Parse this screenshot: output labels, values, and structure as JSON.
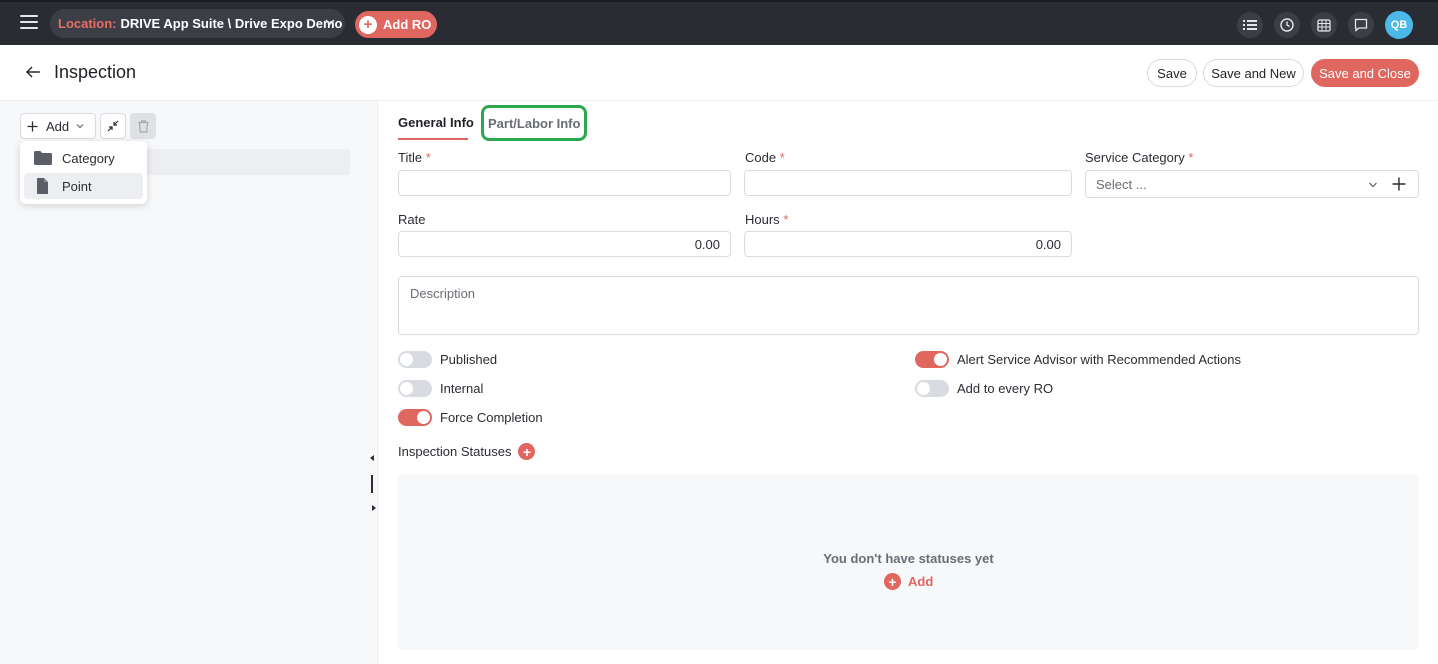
{
  "topbar": {
    "location_label": "Location:",
    "location_value": "DRIVE App Suite \\ Drive Expo Demo",
    "add_ro_label": "Add RO",
    "avatar_initials": "QB",
    "icons": [
      "menu-icon",
      "list-icon",
      "clock-icon",
      "calendar-icon",
      "chat-icon"
    ]
  },
  "header": {
    "title": "Inspection",
    "save_label": "Save",
    "save_new_label": "Save and New",
    "save_close_label": "Save and Close"
  },
  "left_panel": {
    "add_label": "Add",
    "dropdown_items": [
      {
        "label": "Category",
        "icon": "folder-icon"
      },
      {
        "label": "Point",
        "icon": "file-icon"
      }
    ]
  },
  "tabs": [
    {
      "label": "General Info",
      "active": true
    },
    {
      "label": "Part/Labor Info",
      "active": false
    }
  ],
  "form": {
    "title_label": "Title",
    "title_value": "",
    "code_label": "Code",
    "code_value": "",
    "service_category_label": "Service Category",
    "service_category_placeholder": "Select ...",
    "rate_label": "Rate",
    "rate_value": "0.00",
    "hours_label": "Hours",
    "hours_value": "0.00",
    "description_placeholder": "Description",
    "required_mark": "*"
  },
  "toggles": [
    {
      "label": "Published",
      "on": false
    },
    {
      "label": "Internal",
      "on": false
    },
    {
      "label": "Force Completion",
      "on": true
    },
    {
      "label": "Alert Service Advisor with Recommended Actions",
      "on": true
    },
    {
      "label": "Add to every RO",
      "on": false
    }
  ],
  "statuses": {
    "label": "Inspection Statuses",
    "empty_text": "You don't have statuses yet",
    "add_label": "Add"
  },
  "colors": {
    "accent": "#e06660",
    "topbar_bg": "#2a2c33",
    "highlight": "#2ea84f"
  }
}
